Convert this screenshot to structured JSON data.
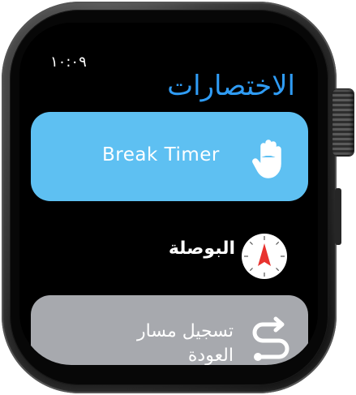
{
  "status": {
    "time": "١٠:٠٩"
  },
  "app": {
    "title": "الاختصارات"
  },
  "shortcuts": [
    {
      "label": "Break Timer",
      "icon": "raised-hand-icon",
      "color": "#5ec0f2"
    },
    {
      "label": "البوصلة",
      "icon": "compass-icon"
    },
    {
      "label": "تسجيل مسار العودة",
      "icon": "route-icon",
      "color": "#a7a9ae"
    }
  ],
  "colors": {
    "accent": "#2f9cf5",
    "background": "#000000"
  }
}
